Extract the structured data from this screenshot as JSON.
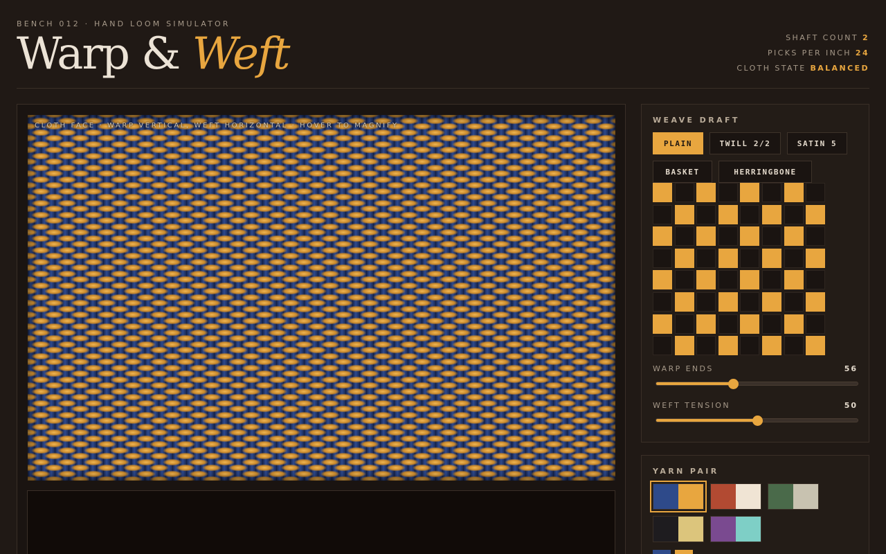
{
  "header": {
    "subtitle": "BENCH 012 · HAND LOOM SIMULATOR",
    "title_plain": "Warp &",
    "title_accent": "Weft",
    "stats": [
      {
        "label": "SHAFT COUNT",
        "value": "2"
      },
      {
        "label": "PICKS PER INCH",
        "value": "24"
      },
      {
        "label": "CLOTH STATE",
        "value": "BALANCED"
      }
    ]
  },
  "cloth": {
    "caption": "CLOTH FACE · WARP VERTICAL, WEFT HORIZONTAL · HOVER TO MAGNIFY"
  },
  "weave_draft": {
    "label": "WEAVE DRAFT",
    "buttons": [
      "PLAIN",
      "TWILL 2/2",
      "SATIN 5",
      "BASKET",
      "HERRINGBONE"
    ],
    "active": "PLAIN",
    "grid": [
      [
        1,
        0,
        1,
        0,
        1,
        0,
        1,
        0
      ],
      [
        0,
        1,
        0,
        1,
        0,
        1,
        0,
        1
      ],
      [
        1,
        0,
        1,
        0,
        1,
        0,
        1,
        0
      ],
      [
        0,
        1,
        0,
        1,
        0,
        1,
        0,
        1
      ],
      [
        1,
        0,
        1,
        0,
        1,
        0,
        1,
        0
      ],
      [
        0,
        1,
        0,
        1,
        0,
        1,
        0,
        1
      ],
      [
        1,
        0,
        1,
        0,
        1,
        0,
        1,
        0
      ],
      [
        0,
        1,
        0,
        1,
        0,
        1,
        0,
        1
      ]
    ],
    "sliders": [
      {
        "label": "WARP ENDS",
        "value": "56",
        "fraction": 0.38
      },
      {
        "label": "WEFT TENSION",
        "value": "50",
        "fraction": 0.5
      }
    ]
  },
  "yarn_pair": {
    "label": "YARN PAIR",
    "pairs": [
      {
        "warp": "#2e4a8a",
        "weft": "#e8a63f",
        "active": true
      },
      {
        "warp": "#b24a32",
        "weft": "#f0e4d4",
        "active": false
      },
      {
        "warp": "#4a6a4a",
        "weft": "#c8c2b0",
        "active": false
      },
      {
        "warp": "#1e1c1f",
        "weft": "#dcc57c",
        "active": false
      },
      {
        "warp": "#7a4a90",
        "weft": "#7ecfc6",
        "active": false
      }
    ]
  },
  "colors": {
    "accent": "#e8a63f",
    "background": "#201915",
    "panel": "#231c17",
    "warp": "#2e4a8a",
    "weft": "#e8a63f"
  }
}
